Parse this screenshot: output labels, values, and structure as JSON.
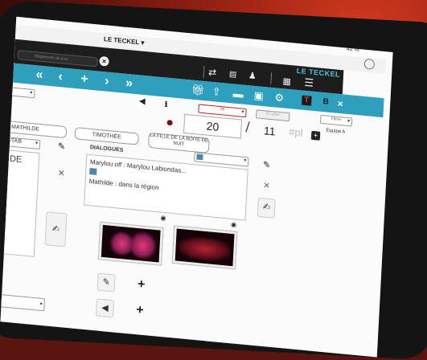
{
  "status": {
    "dots": "•••",
    "battery": "42 %"
  },
  "window": {
    "title": "LE TECKEL ▾"
  },
  "toolbar": {
    "brand": "LE TECKEL",
    "day_filter_placeholder": "Séquences du jour",
    "clear_icon": "close-circle-icon",
    "icons": [
      "swap-arrows-icon",
      "pdf-icon",
      "person-list-icon",
      "clapperboard-icon",
      "menu-lines-icon"
    ]
  },
  "nav": {
    "first": "«",
    "prev": "‹",
    "add": "+",
    "next": "›",
    "last": "»",
    "tools": [
      "gift-icon",
      "share-icon",
      "camera-icon",
      "portrait-icon",
      "gear-icon"
    ],
    "t_label": "T",
    "b_label": "B",
    "close_label": "×"
  },
  "scene": {
    "left_dropdown": "",
    "day_dropdown": "20",
    "day_value_small": "En plan",
    "filter_label": "Filtre/",
    "team_label": "Equipe A",
    "seq_number": "20",
    "slash": "/",
    "part_number": "11",
    "pl_label": "#pl"
  },
  "characters": [
    "MATHILDE",
    "TIMOTHÉE",
    "LA FILLE DE LA BOITE DE NUIT"
  ],
  "setup": {
    "column_label": "STAB",
    "column_value": "DE"
  },
  "dialogues": {
    "header": "DIALOGUES",
    "lines": [
      "Marylou off : Marylou Labiondas...",
      "Mathilde : dans la région"
    ]
  },
  "colors": {
    "toolbar_blue": "#2f9fbe",
    "brand_cyan": "#4ec6dc",
    "accent_red": "#e23b2b",
    "dark_bar": "#1d1d1d"
  }
}
